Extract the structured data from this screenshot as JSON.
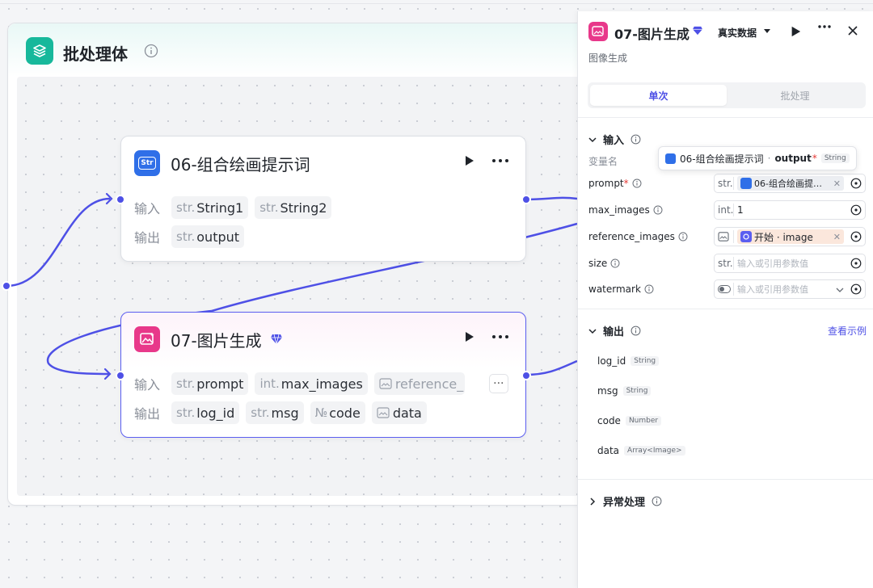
{
  "batch": {
    "title": "批处理体"
  },
  "node06": {
    "icon_text": "Str",
    "title": "06-组合绘画提示词",
    "input_label": "输入",
    "output_label": "输出",
    "inputs": [
      {
        "type": "str.",
        "name": "String1"
      },
      {
        "type": "str.",
        "name": "String2"
      }
    ],
    "outputs": [
      {
        "type": "str.",
        "name": "output"
      }
    ]
  },
  "node07": {
    "title": "07-图片生成",
    "input_label": "输入",
    "output_label": "输出",
    "inputs": [
      {
        "type": "str.",
        "name": "prompt"
      },
      {
        "type": "int.",
        "name": "max_images"
      },
      {
        "type": "",
        "name": "reference_"
      }
    ],
    "more": "···",
    "outputs": [
      {
        "type": "str.",
        "name": "log_id"
      },
      {
        "type": "str.",
        "name": "msg"
      },
      {
        "type": "№",
        "name": "code"
      },
      {
        "type": "",
        "name": "data"
      }
    ]
  },
  "panel": {
    "title": "07-图片生成",
    "mode": "真实数据",
    "subtitle": "图像生成",
    "tabs": [
      "单次",
      "批处理"
    ],
    "input_section": "输入",
    "var_name_label": "变量名",
    "tooltip": {
      "source": "06-组合绘画提示词",
      "sep": "·",
      "field": "output",
      "req": "*",
      "type": "String"
    },
    "params": [
      {
        "label": "prompt",
        "required": "*",
        "type": "str.",
        "ref": "06-组合绘画提…"
      },
      {
        "label": "max_images",
        "type": "int.",
        "value": "1"
      },
      {
        "label": "reference_images",
        "ref": "开始 · image"
      },
      {
        "label": "size",
        "type": "str.",
        "placeholder": "输入或引用参数值"
      },
      {
        "label": "watermark",
        "placeholder": "输入或引用参数值"
      }
    ],
    "output_section": "输出",
    "view_example": "查看示例",
    "outputs": [
      {
        "name": "log_id",
        "type": "String"
      },
      {
        "name": "msg",
        "type": "String"
      },
      {
        "name": "code",
        "type": "Number"
      },
      {
        "name": "data",
        "type": "Array<Image>"
      }
    ],
    "error_section": "异常处理"
  },
  "colors": {
    "accent": "#4e50e6",
    "batch_icon": "#17b89b",
    "image_icon": "#e8388a",
    "str_icon": "#2f6fe8"
  }
}
